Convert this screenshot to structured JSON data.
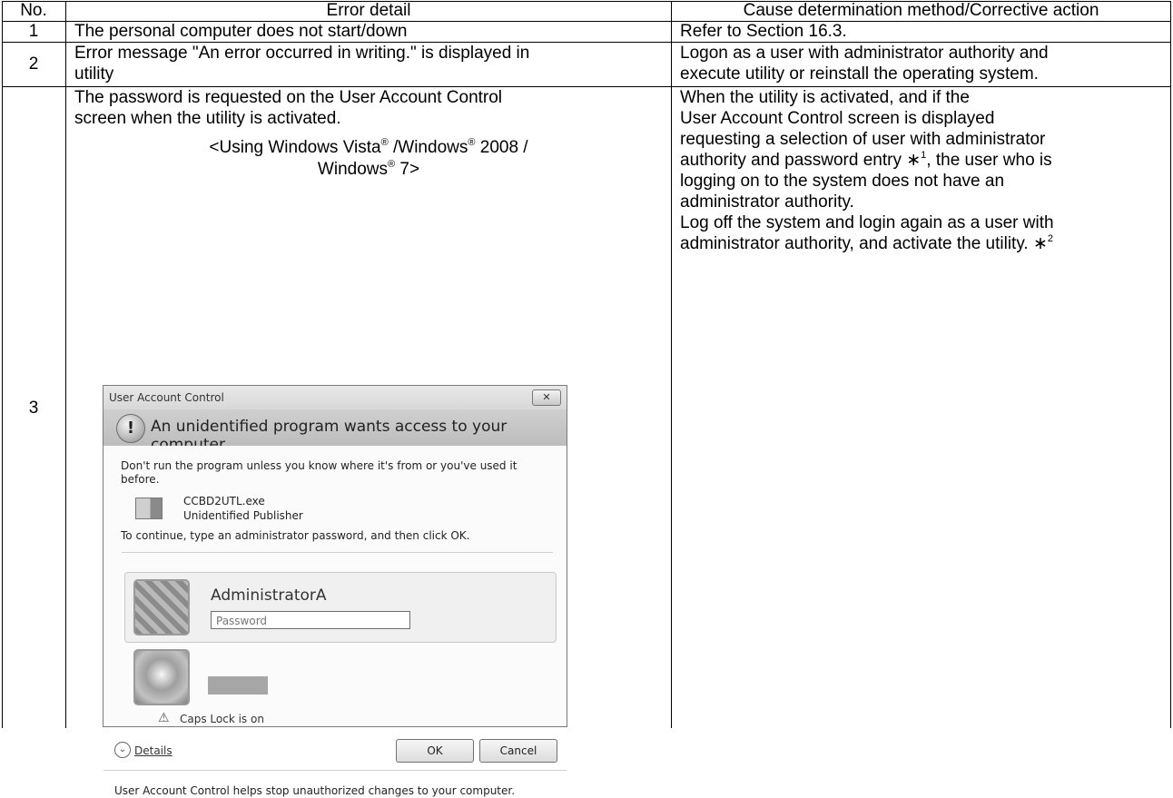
{
  "table": {
    "headers": [
      "No.",
      "Error detail",
      "Cause determination method/Corrective action"
    ],
    "rows": [
      {
        "no": "1",
        "detail": "The personal computer does not start/down",
        "action": "Refer to Section 16.3."
      },
      {
        "no": "2",
        "detail_lines": [
          "Error message \"An error occurred in writing.\" is displayed in",
          "utility"
        ],
        "action_lines": [
          "Logon as a user with administrator authority and",
          "execute utility or reinstall the operating system."
        ]
      },
      {
        "no": "3",
        "detail_lines": [
          "The password is requested on the User Account Control",
          "screen when the utility is activated."
        ],
        "caption": {
          "prefix": "<Using Windows Vista",
          "mid1": " /Windows",
          "mid2": " 2008 /",
          "line2": "Windows",
          "line2_end": " 7>",
          "reg": "®"
        },
        "action_lines": [
          "When the utility is activated, and if the",
          " User Account Control screen is displayed",
          "requesting a selection of user with administrator",
          "authority and password entry ",
          ", the user who is",
          "logging on to the system does not have an",
          "administrator authority.",
          "Log off the system and login again as a user with",
          "administrator authority, and activate the utility.  "
        ],
        "note_mark": "∗",
        "note1": "1",
        "note2": "2"
      }
    ]
  },
  "uac_dialog": {
    "title": "User Account Control",
    "close_label": "✕",
    "banner": "An unidentified program wants access to your computer",
    "warning_lines": [
      "Don't run the program unless you know where it's from or you've used it",
      "before."
    ],
    "program_name": "CCBD2UTL.exe",
    "publisher": "Unidentified Publisher",
    "instruction": "To continue, type an administrator password, and then click OK.",
    "user_name": "AdministratorA",
    "password_placeholder": "Password",
    "caps_lock": "Caps Lock is on",
    "details": "Details",
    "ok": "OK",
    "cancel": "Cancel",
    "footer": "User Account Control helps stop unauthorized changes to your computer."
  }
}
